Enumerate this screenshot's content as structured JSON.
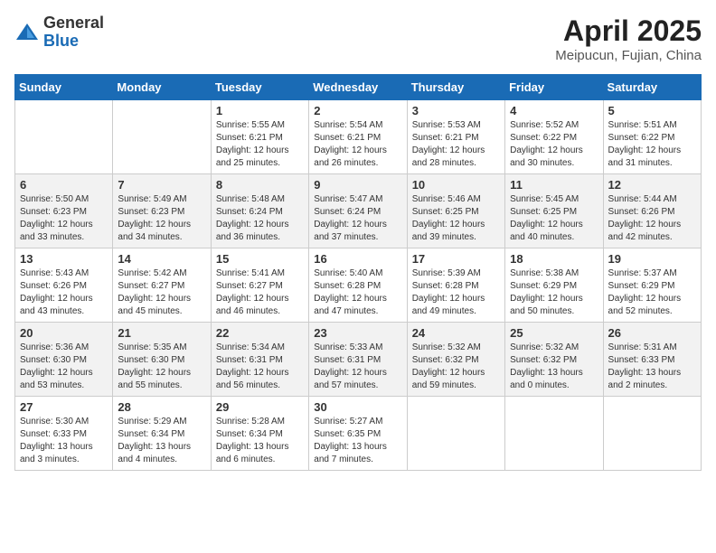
{
  "logo": {
    "general": "General",
    "blue": "Blue"
  },
  "title": "April 2025",
  "location": "Meipucun, Fujian, China",
  "days_of_week": [
    "Sunday",
    "Monday",
    "Tuesday",
    "Wednesday",
    "Thursday",
    "Friday",
    "Saturday"
  ],
  "weeks": [
    [
      null,
      null,
      {
        "day": 1,
        "sunrise": "5:55 AM",
        "sunset": "6:21 PM",
        "daylight": "12 hours and 25 minutes."
      },
      {
        "day": 2,
        "sunrise": "5:54 AM",
        "sunset": "6:21 PM",
        "daylight": "12 hours and 26 minutes."
      },
      {
        "day": 3,
        "sunrise": "5:53 AM",
        "sunset": "6:21 PM",
        "daylight": "12 hours and 28 minutes."
      },
      {
        "day": 4,
        "sunrise": "5:52 AM",
        "sunset": "6:22 PM",
        "daylight": "12 hours and 30 minutes."
      },
      {
        "day": 5,
        "sunrise": "5:51 AM",
        "sunset": "6:22 PM",
        "daylight": "12 hours and 31 minutes."
      }
    ],
    [
      {
        "day": 6,
        "sunrise": "5:50 AM",
        "sunset": "6:23 PM",
        "daylight": "12 hours and 33 minutes."
      },
      {
        "day": 7,
        "sunrise": "5:49 AM",
        "sunset": "6:23 PM",
        "daylight": "12 hours and 34 minutes."
      },
      {
        "day": 8,
        "sunrise": "5:48 AM",
        "sunset": "6:24 PM",
        "daylight": "12 hours and 36 minutes."
      },
      {
        "day": 9,
        "sunrise": "5:47 AM",
        "sunset": "6:24 PM",
        "daylight": "12 hours and 37 minutes."
      },
      {
        "day": 10,
        "sunrise": "5:46 AM",
        "sunset": "6:25 PM",
        "daylight": "12 hours and 39 minutes."
      },
      {
        "day": 11,
        "sunrise": "5:45 AM",
        "sunset": "6:25 PM",
        "daylight": "12 hours and 40 minutes."
      },
      {
        "day": 12,
        "sunrise": "5:44 AM",
        "sunset": "6:26 PM",
        "daylight": "12 hours and 42 minutes."
      }
    ],
    [
      {
        "day": 13,
        "sunrise": "5:43 AM",
        "sunset": "6:26 PM",
        "daylight": "12 hours and 43 minutes."
      },
      {
        "day": 14,
        "sunrise": "5:42 AM",
        "sunset": "6:27 PM",
        "daylight": "12 hours and 45 minutes."
      },
      {
        "day": 15,
        "sunrise": "5:41 AM",
        "sunset": "6:27 PM",
        "daylight": "12 hours and 46 minutes."
      },
      {
        "day": 16,
        "sunrise": "5:40 AM",
        "sunset": "6:28 PM",
        "daylight": "12 hours and 47 minutes."
      },
      {
        "day": 17,
        "sunrise": "5:39 AM",
        "sunset": "6:28 PM",
        "daylight": "12 hours and 49 minutes."
      },
      {
        "day": 18,
        "sunrise": "5:38 AM",
        "sunset": "6:29 PM",
        "daylight": "12 hours and 50 minutes."
      },
      {
        "day": 19,
        "sunrise": "5:37 AM",
        "sunset": "6:29 PM",
        "daylight": "12 hours and 52 minutes."
      }
    ],
    [
      {
        "day": 20,
        "sunrise": "5:36 AM",
        "sunset": "6:30 PM",
        "daylight": "12 hours and 53 minutes."
      },
      {
        "day": 21,
        "sunrise": "5:35 AM",
        "sunset": "6:30 PM",
        "daylight": "12 hours and 55 minutes."
      },
      {
        "day": 22,
        "sunrise": "5:34 AM",
        "sunset": "6:31 PM",
        "daylight": "12 hours and 56 minutes."
      },
      {
        "day": 23,
        "sunrise": "5:33 AM",
        "sunset": "6:31 PM",
        "daylight": "12 hours and 57 minutes."
      },
      {
        "day": 24,
        "sunrise": "5:32 AM",
        "sunset": "6:32 PM",
        "daylight": "12 hours and 59 minutes."
      },
      {
        "day": 25,
        "sunrise": "5:32 AM",
        "sunset": "6:32 PM",
        "daylight": "13 hours and 0 minutes."
      },
      {
        "day": 26,
        "sunrise": "5:31 AM",
        "sunset": "6:33 PM",
        "daylight": "13 hours and 2 minutes."
      }
    ],
    [
      {
        "day": 27,
        "sunrise": "5:30 AM",
        "sunset": "6:33 PM",
        "daylight": "13 hours and 3 minutes."
      },
      {
        "day": 28,
        "sunrise": "5:29 AM",
        "sunset": "6:34 PM",
        "daylight": "13 hours and 4 minutes."
      },
      {
        "day": 29,
        "sunrise": "5:28 AM",
        "sunset": "6:34 PM",
        "daylight": "13 hours and 6 minutes."
      },
      {
        "day": 30,
        "sunrise": "5:27 AM",
        "sunset": "6:35 PM",
        "daylight": "13 hours and 7 minutes."
      },
      null,
      null,
      null
    ]
  ],
  "labels": {
    "sunrise": "Sunrise:",
    "sunset": "Sunset:",
    "daylight": "Daylight:"
  }
}
